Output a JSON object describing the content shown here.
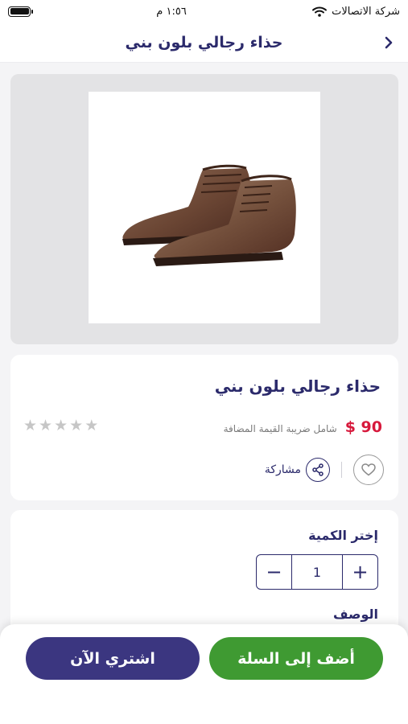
{
  "status_bar": {
    "carrier": "شركة الاتصالات",
    "time": "١:٥٦ م"
  },
  "header": {
    "title": "حذاء رجالي بلون بني"
  },
  "product": {
    "image": "brown-leather-chukka-boots",
    "title": "حذاء رجالي بلون بني",
    "price": "$ 90",
    "tax_note": "شامل ضريبة القيمة المضافة",
    "rating": 0,
    "rating_max": 5,
    "share_label": "مشاركة"
  },
  "quantity": {
    "label": "إختر الكمية",
    "value": "1",
    "minus": "−",
    "plus": "+"
  },
  "description": {
    "label": "الوصف"
  },
  "actions": {
    "buy_now": "اشتري الآن",
    "add_to_cart": "أضف إلى السلة"
  },
  "colors": {
    "primary": "#2b2a6b",
    "buy_now": "#3b3680",
    "add_to_cart": "#3f9a32",
    "price": "#d7193c"
  }
}
